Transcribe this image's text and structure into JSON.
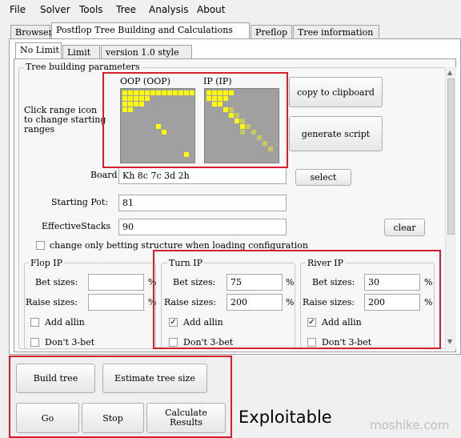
{
  "menu": [
    "File",
    "Solver",
    "Tools",
    "Tree",
    "Analysis",
    "About"
  ],
  "main_tabs": [
    "Browser",
    "Postflop Tree Building and Calculations",
    "Preflop",
    "Tree information"
  ],
  "sub_tabs": [
    "No Limit",
    "Limit",
    "version 1.0 style"
  ],
  "tree_params": {
    "title": "Tree building parameters",
    "click_range_text": "Click range icon\nto change starting\nranges",
    "oop_label": "OOP (OOP)",
    "ip_label": "IP (IP)",
    "copy_button": "copy to clipboard",
    "generate_button": "generate script",
    "board_label": "Board",
    "board_value": "Kh 8c 7c 3d 2h",
    "select_button": "select",
    "starting_pot_label": "Starting Pot:",
    "starting_pot_value": "81",
    "effective_stacks_label": "EffectiveStacks",
    "effective_stacks_value": "90",
    "clear_button": "clear",
    "change_only_label": "change only betting structure when loading configuration"
  },
  "flop": {
    "title": "Flop IP",
    "bet_label": "Bet sizes:",
    "bet_value": "",
    "raise_label": "Raise sizes:",
    "raise_value": "",
    "allin_label": "Add allin",
    "no3bet_label": "Don't 3-bet",
    "allin_checked": false
  },
  "turn": {
    "title": "Turn IP",
    "bet_label": "Bet sizes:",
    "bet_value": "75",
    "raise_label": "Raise sizes:",
    "raise_value": "200",
    "allin_label": "Add allin",
    "no3bet_label": "Don't 3-bet",
    "allin_checked": true
  },
  "river": {
    "title": "River IP",
    "bet_label": "Bet sizes:",
    "bet_value": "30",
    "raise_label": "Raise sizes:",
    "raise_value": "200",
    "allin_label": "Add allin",
    "no3bet_label": "Don't 3-bet",
    "allin_checked": true
  },
  "percent": "%",
  "check_mark": "✓",
  "actions": {
    "build": "Build tree",
    "estimate": "Estimate tree size",
    "go": "Go",
    "stop": "Stop",
    "calculate": "Calculate\nResults"
  },
  "annotation": "Exploitable",
  "watermark": "moshike.com",
  "colors": {
    "highlight": "#d8202a",
    "range_yellow": "#ffff00",
    "range_dim": "#c8c860"
  }
}
